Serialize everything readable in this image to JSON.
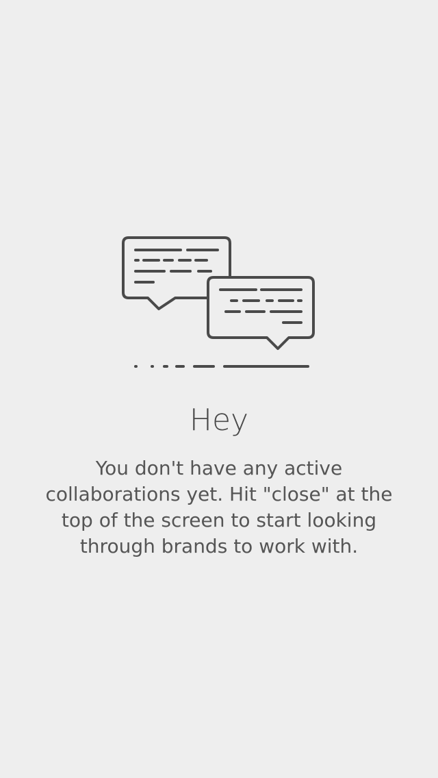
{
  "empty_state": {
    "icon": "chat-bubbles-icon",
    "title": "Hey",
    "message": "You don't have any active collaborations yet. Hit \"close\" at the top of the screen to start looking through brands to work with."
  },
  "colors": {
    "background": "#eeeeee",
    "icon_stroke": "#4a4a4a",
    "text": "#555555"
  }
}
